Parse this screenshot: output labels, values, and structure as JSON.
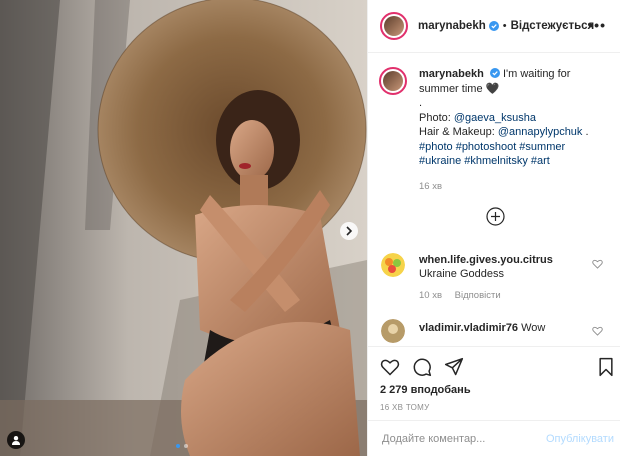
{
  "post": {
    "username": "marynabekh",
    "follow_status": "Відстежується",
    "caption_text": "I'm waiting for summer time 🖤",
    "caption_dot": ".",
    "photo_label": "Photo: ",
    "photo_credit": "@gaeva_ksusha",
    "hair_label": "Hair & Makeup: ",
    "hair_credit": "@annapylypchuk",
    "hair_suffix": " .",
    "hashtags_line1": "#photo #photoshoot #summer",
    "hashtags_line2": "#ukraine #khmelnitsky #art",
    "caption_time": "16 хв",
    "likes": "2 279 вподобань",
    "posted_ago": "16 ХВ ТОМУ"
  },
  "comments": [
    {
      "user": "when.life.gives.you.citrus",
      "text": "Ukraine Goddess",
      "time": "10 хв",
      "reply": "Відповісти"
    },
    {
      "user": "vladimir.vladimir76",
      "text": "Wow"
    }
  ],
  "add_comment": {
    "placeholder": "Додайте коментар...",
    "publish_label": "Опублікувати"
  },
  "icons": [
    "more-icon",
    "verified-icon",
    "plus-circle-icon",
    "heart-icon",
    "comment-icon",
    "share-icon",
    "bookmark-icon",
    "next-arrow-icon",
    "user-tag-icon"
  ],
  "colors": {
    "link": "#00376b",
    "muted": "#8e8e8e",
    "publish_disabled": "#b3dbff",
    "story_ring": "#e1306c",
    "verified": "#3897f0"
  }
}
